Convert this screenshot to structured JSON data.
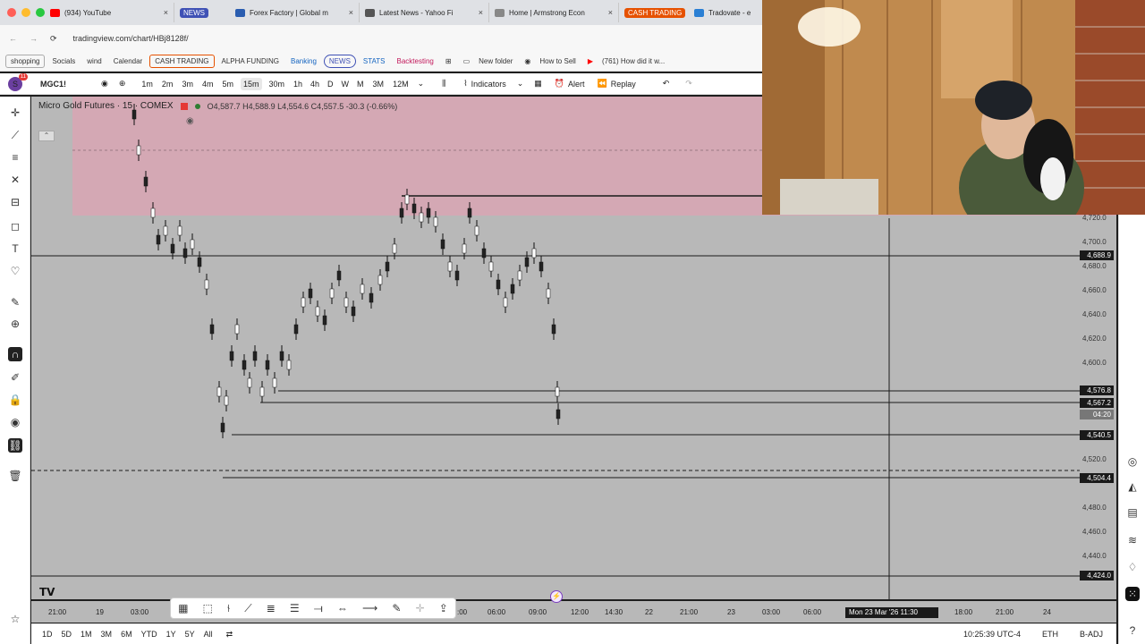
{
  "browser": {
    "tabs": [
      {
        "title": "(934) YouTube",
        "icon": "youtube-icon",
        "color": "#ff0000"
      },
      {
        "title": "Forex Factory | Global m",
        "icon": "forexfactory-icon",
        "color": "#2a5db0"
      },
      {
        "title": "Latest News - Yahoo Fi",
        "icon": "yahoo-icon",
        "color": "#555555"
      },
      {
        "title": "Home | Armstrong Econ",
        "icon": "armstrong-icon",
        "color": "#888888"
      },
      {
        "title": "Tradovate - e",
        "icon": "tradovate-icon",
        "color": "#2a7fd4"
      }
    ],
    "badge_news": "NEWS",
    "badge_cash": "CASH TRADING",
    "url": "tradingview.com/chart/HBj8128f/"
  },
  "bookmarks": [
    "shopping",
    "Socials",
    "wind",
    "Calendar",
    "CASH TRADING",
    "ALPHA FUNDING",
    "Banking",
    "NEWS",
    "STATS",
    "Backtesting",
    "New folder",
    "How to Sell",
    "(761) How did it w..."
  ],
  "toolbar": {
    "avatar_letter": "S",
    "avatar_badge": "11",
    "symbol": "MGC1!",
    "intervals": [
      "1m",
      "2m",
      "3m",
      "4m",
      "5m",
      "15m",
      "30m",
      "1h",
      "4h",
      "D",
      "W",
      "M",
      "3M",
      "12M"
    ],
    "active_interval": "15m",
    "indicators_label": "Indicators",
    "alert_label": "Alert",
    "replay_label": "Replay"
  },
  "legend": {
    "title": "Micro Gold Futures · 15 · COMEX",
    "ohlc": "O4,587.7 H4,588.9 L4,554.6 C4,557.5 -30.3 (-0.66%)"
  },
  "price_axis": {
    "ticks": [
      "4,720.0",
      "4,700.0",
      "4,680.0",
      "4,660.0",
      "4,640.0",
      "4,620.0",
      "4,600.0",
      "4,520.0",
      "4,480.0",
      "4,460.0",
      "4,440.0"
    ],
    "tags": [
      {
        "label": "4,688.9",
        "style": "dark"
      },
      {
        "label": "4,576.8",
        "style": "dark"
      },
      {
        "label": "4,567.2",
        "style": "dark"
      },
      {
        "label": "04:20",
        "style": "gray"
      },
      {
        "label": "4,540.5",
        "style": "dark"
      },
      {
        "label": "4,504.4",
        "style": "dark"
      },
      {
        "label": "4,424.0",
        "style": "dark"
      }
    ]
  },
  "time_axis": {
    "ticks": [
      "21:00",
      "19",
      "03:00",
      ":00",
      "06:00",
      "09:00",
      "12:00",
      "14:30",
      "22",
      "21:00",
      "23",
      "03:00",
      "06:00",
      "18:00",
      "21:00",
      "24"
    ],
    "crosshair_time": "Mon 23 Mar '26  11:30"
  },
  "ranges": [
    "1D",
    "5D",
    "1M",
    "3M",
    "6M",
    "YTD",
    "1Y",
    "5Y",
    "All"
  ],
  "status": {
    "clock": "10:25:39 UTC-4",
    "session": "ETH",
    "adj": "B-ADJ"
  },
  "colors": {
    "zone": "#d4a8b4",
    "chart_bg": "#b8b8b8",
    "candle": "#ffffff",
    "line": "#1a1a1a"
  }
}
